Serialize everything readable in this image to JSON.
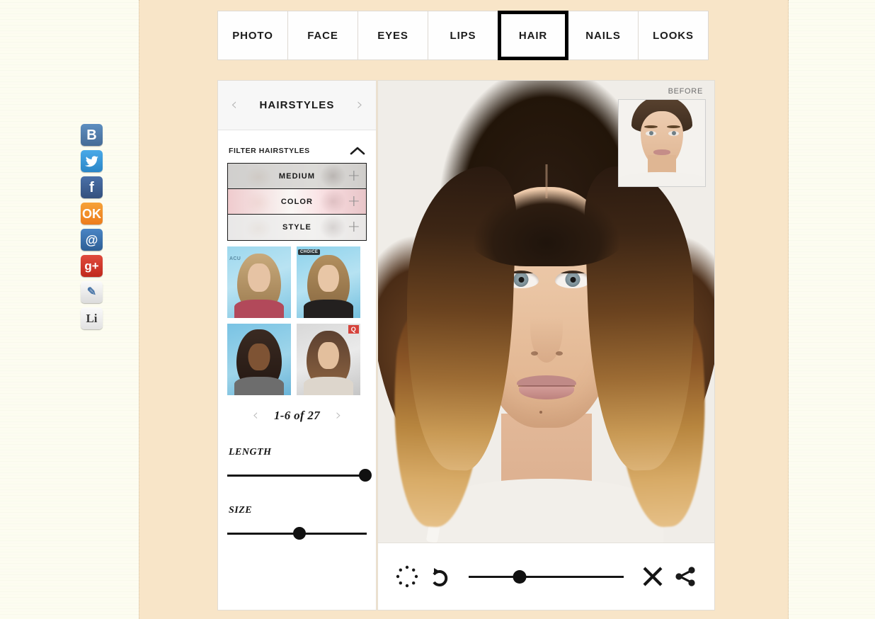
{
  "page": {
    "background_color": "#fdfbef",
    "content_background": "#f8e5c8"
  },
  "social_sidebar": {
    "items": [
      {
        "name": "vkontakte",
        "label": "B",
        "color": "#5d8ec0"
      },
      {
        "name": "twitter",
        "label": "⬤",
        "color": "#4aa9e8"
      },
      {
        "name": "facebook",
        "label": "f",
        "color": "#4a6fa8"
      },
      {
        "name": "odnoklassniki",
        "label": "OK",
        "color": "#f6a238"
      },
      {
        "name": "mailru",
        "label": "@",
        "color": "#4a85c5"
      },
      {
        "name": "googleplus",
        "label": "g+",
        "color": "#e04a3c"
      },
      {
        "name": "livejournal",
        "label": "✎",
        "color": "#fbfbfb"
      },
      {
        "name": "liveinternet",
        "label": "Li",
        "color": "#fafafa"
      }
    ]
  },
  "tabs": {
    "items": [
      {
        "label": "PHOTO",
        "active": false
      },
      {
        "label": "FACE",
        "active": false
      },
      {
        "label": "EYES",
        "active": false
      },
      {
        "label": "LIPS",
        "active": false
      },
      {
        "label": "HAIR",
        "active": true
      },
      {
        "label": "NAILS",
        "active": false
      },
      {
        "label": "LOOKS",
        "active": false
      }
    ]
  },
  "control_panel": {
    "header": {
      "title": "HAIRSTYLES",
      "prev_icon": "chevron-left-icon",
      "next_icon": "chevron-right-icon"
    },
    "filter": {
      "label": "FILTER HAIRSTYLES",
      "collapse_icon": "chevron-up-icon",
      "expanded": true,
      "rows": [
        {
          "label": "MEDIUM",
          "add_icon": "plus-icon"
        },
        {
          "label": "COLOR",
          "add_icon": "plus-icon"
        },
        {
          "label": "STYLE",
          "add_icon": "plus-icon"
        }
      ]
    },
    "thumbnails": [
      {
        "name": "hairstyle-thumb-1",
        "alt": "long wavy blonde hairstyle"
      },
      {
        "name": "hairstyle-thumb-2",
        "alt": "side-swept wavy bronde hairstyle"
      },
      {
        "name": "hairstyle-thumb-3",
        "alt": "straight black hair with blunt bangs"
      },
      {
        "name": "hairstyle-thumb-4",
        "alt": "shoulder-length ombre waves"
      }
    ],
    "pagination": {
      "label": "1-6 of 27",
      "prev_icon": "chevron-left-icon",
      "next_icon": "chevron-right-icon",
      "range_start": 1,
      "range_end": 6,
      "total": 27
    },
    "sliders": [
      {
        "name": "length-slider",
        "label": "LENGTH",
        "value": 99
      },
      {
        "name": "size-slider",
        "label": "SIZE",
        "value": 52
      }
    ]
  },
  "photo_panel": {
    "before": {
      "label": "BEFORE",
      "alt": "original photo without hairstyle applied"
    },
    "main_photo_alt": "model with brown-to-blonde ombre shoulder-length wavy hair",
    "toolbar": {
      "items": [
        {
          "name": "compare-button",
          "icon": "dotted-circle-icon"
        },
        {
          "name": "undo-button",
          "icon": "undo-arrow-icon"
        },
        {
          "name": "opacity-slider",
          "icon": "slider",
          "value": 33
        },
        {
          "name": "close-button",
          "icon": "close-x-icon"
        },
        {
          "name": "share-button",
          "icon": "share-icon"
        }
      ]
    }
  }
}
